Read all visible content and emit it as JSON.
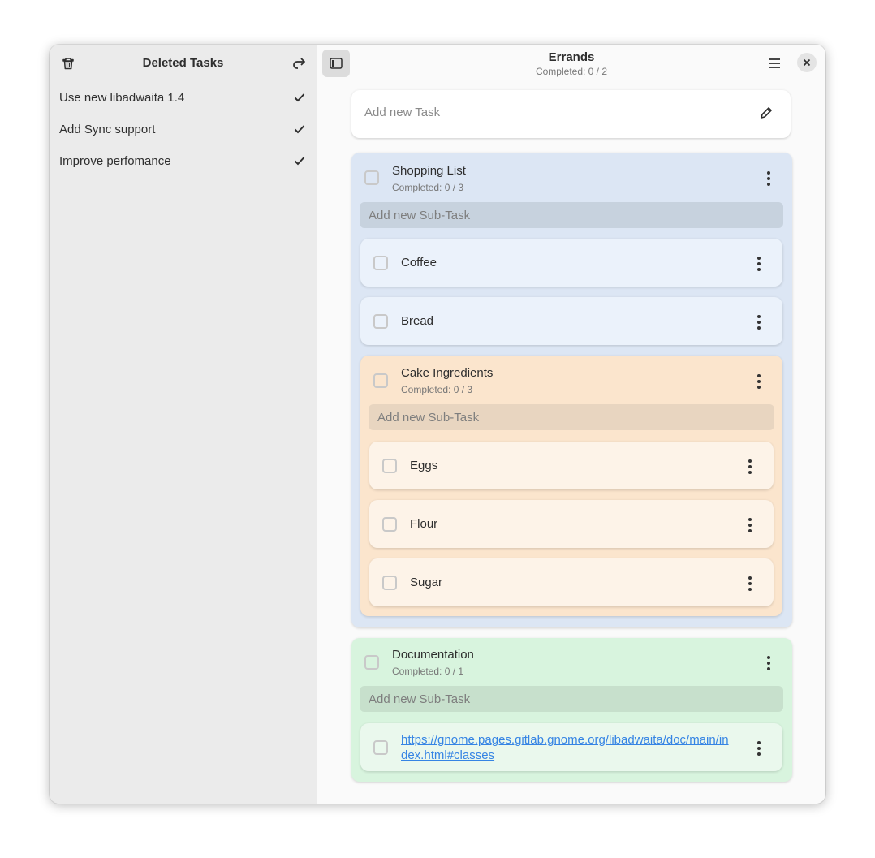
{
  "sidebar": {
    "title": "Deleted Tasks",
    "items": [
      {
        "label": "Use new libadwaita 1.4"
      },
      {
        "label": "Add Sync support"
      },
      {
        "label": "Improve perfomance"
      }
    ]
  },
  "header": {
    "title": "Errands",
    "subtitle": "Completed: 0 / 2"
  },
  "new_task": {
    "placeholder": "Add new Task"
  },
  "tasks": [
    {
      "title": "Shopping List",
      "completed": "Completed: 0 / 3",
      "sub_placeholder": "Add new Sub-Task",
      "subtasks": [
        {
          "title": "Coffee"
        },
        {
          "title": "Bread"
        },
        {
          "title": "Cake Ingredients",
          "completed": "Completed: 0 / 3",
          "sub_placeholder": "Add new Sub-Task",
          "subtasks": [
            {
              "title": "Eggs"
            },
            {
              "title": "Flour"
            },
            {
              "title": "Sugar"
            }
          ]
        }
      ]
    },
    {
      "title": "Documentation",
      "completed": "Completed: 0 / 1",
      "sub_placeholder": "Add new Sub-Task",
      "subtasks": [
        {
          "title": "https://gnome.pages.gitlab.gnome.org/libadwaita/doc/main/index.html#classes"
        }
      ]
    }
  ],
  "colors": {
    "blue": "#dce6f4",
    "orange": "#fbe5cd",
    "green": "#d8f4de",
    "link": "#3584e4"
  }
}
